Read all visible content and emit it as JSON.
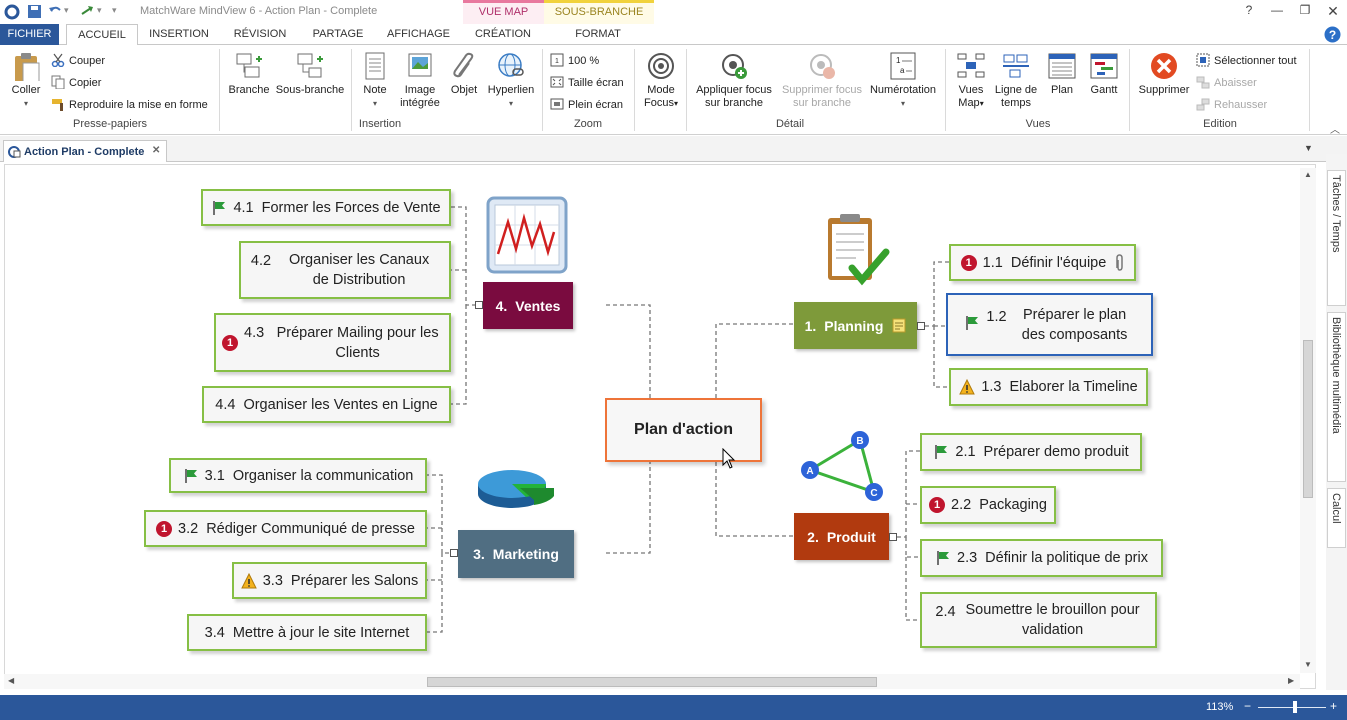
{
  "app": {
    "title": "MatchWare MindView 6 - Action Plan - Complete",
    "context_tabs": [
      "VUE MAP",
      "SOUS-BRANCHE"
    ]
  },
  "ribbon_tabs": [
    "FICHIER",
    "ACCUEIL",
    "INSERTION",
    "RÉVISION",
    "PARTAGE",
    "AFFICHAGE",
    "CRÉATION",
    "FORMAT"
  ],
  "ribbon": {
    "presse_papiers": {
      "label": "Presse-papiers",
      "coller": "Coller",
      "couper": "Couper",
      "copier": "Copier",
      "reproduire": "Reproduire la mise en forme"
    },
    "insertion": {
      "label": "Insertion",
      "branche": "Branche",
      "sous_branche": "Sous-branche",
      "note": "Note",
      "image_1": "Image",
      "image_2": "intégrée",
      "objet": "Objet",
      "hyperlien": "Hyperlien"
    },
    "zoom": {
      "label": "Zoom",
      "pct": "100 %",
      "taille": "Taille écran",
      "plein": "Plein écran"
    },
    "detail": {
      "label": "Détail",
      "mode_1": "Mode",
      "mode_2": "Focus",
      "appliquer_1": "Appliquer focus",
      "appliquer_2": "sur branche",
      "supprimer_1": "Supprimer focus",
      "supprimer_2": "sur branche",
      "numerotation": "Numérotation"
    },
    "vues": {
      "label": "Vues",
      "vues_map_1": "Vues",
      "vues_map_2": "Map",
      "ligne_1": "Ligne de",
      "ligne_2": "temps",
      "plan": "Plan",
      "gantt": "Gantt"
    },
    "edition": {
      "label": "Edition",
      "supprimer": "Supprimer",
      "selectionner": "Sélectionner tout",
      "abaisser": "Abaisser",
      "rehausser": "Rehausser"
    }
  },
  "document_tab": "Action Plan - Complete",
  "side_tabs": [
    "Tâches / Temps",
    "Bibliothèque multimédia",
    "Calcul"
  ],
  "status": {
    "zoom": "113%"
  },
  "map": {
    "central": "Plan d'action",
    "branches": {
      "planning": {
        "num": "1.",
        "label": "Planning",
        "color": "#7e9a3a"
      },
      "produit": {
        "num": "2.",
        "label": "Produit",
        "color": "#b13a0f"
      },
      "marketing": {
        "num": "3.",
        "label": "Marketing",
        "color": "#506e82"
      },
      "ventes": {
        "num": "4.",
        "label": "Ventes",
        "color": "#7a0b3f"
      }
    },
    "planning_topics": [
      {
        "num": "1.1",
        "label": "Définir l'équipe",
        "marker": "priority-1"
      },
      {
        "num": "1.2",
        "label": "Préparer le plan des composants",
        "marker": "flag"
      },
      {
        "num": "1.3",
        "label": "Elaborer la Timeline",
        "marker": "warning"
      }
    ],
    "produit_topics": [
      {
        "num": "2.1",
        "label": "Préparer demo produit",
        "marker": "flag"
      },
      {
        "num": "2.2",
        "label": "Packaging",
        "marker": "priority-1"
      },
      {
        "num": "2.3",
        "label": "Définir la politique de prix",
        "marker": "flag"
      },
      {
        "num": "2.4",
        "label": "Soumettre le brouillon pour validation",
        "marker": "none"
      }
    ],
    "marketing_topics": [
      {
        "num": "3.1",
        "label": "Organiser la communication",
        "marker": "flag"
      },
      {
        "num": "3.2",
        "label": "Rédiger Communiqué de presse",
        "marker": "priority-1"
      },
      {
        "num": "3.3",
        "label": "Préparer les Salons",
        "marker": "warning"
      },
      {
        "num": "3.4",
        "label": "Mettre à jour le site Internet",
        "marker": "none"
      }
    ],
    "ventes_topics": [
      {
        "num": "4.1",
        "label": "Former les Forces de Vente",
        "marker": "flag"
      },
      {
        "num": "4.2",
        "label": "Organiser les Canaux de Distribution",
        "marker": "none"
      },
      {
        "num": "4.3",
        "label": "Préparer Mailing pour les Clients",
        "marker": "priority-1"
      },
      {
        "num": "4.4",
        "label": "Organiser les Ventes en Ligne",
        "marker": "none"
      }
    ],
    "priority_text": "1",
    "colors": {
      "topic_border": "#86bf45",
      "central_border": "#ee7439",
      "selected_border": "#2d63b8"
    }
  }
}
